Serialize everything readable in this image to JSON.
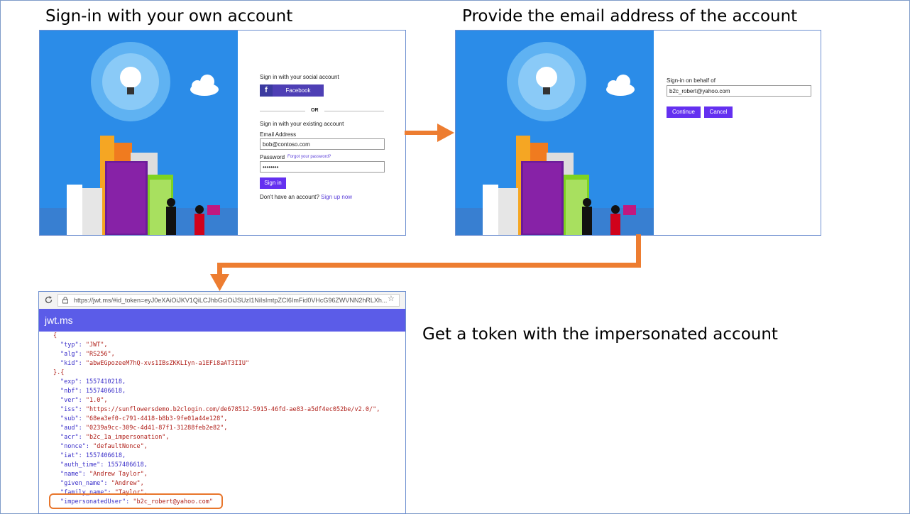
{
  "captions": {
    "step1": "Sign-in with your own account",
    "step2": "Provide the email address of the account",
    "step3": "Get a token with the impersonated account"
  },
  "signin": {
    "social_title": "Sign in with your social account",
    "facebook_label": "Facebook",
    "or_label": "OR",
    "existing_title": "Sign in with your existing account",
    "email_label": "Email Address",
    "email_value": "bob@contoso.com",
    "password_label": "Password",
    "forgot_link": "Forgot your password?",
    "password_value": "••••••••",
    "signin_button": "Sign in",
    "no_account": "Don't have an account?",
    "signup_link": "Sign up now"
  },
  "behalf": {
    "label": "Sign-in on behalf of",
    "value": "b2c_robert@yahoo.com",
    "continue_button": "Continue",
    "cancel_button": "Cancel"
  },
  "browser": {
    "url": "https://jwt.ms/#id_token=eyJ0eXAiOiJKV1QiLCJhbGciOiJSUzI1NiIsImtpZCI6ImFid0VHcG96ZWVNN2hRLXh...",
    "site_title": "jwt.ms",
    "refresh_icon": "refresh-icon",
    "lock_icon": "lock-icon",
    "star_icon": "star-icon"
  },
  "token": {
    "header": [
      {
        "key": "\"typ\"",
        "val": "\"JWT\","
      },
      {
        "key": "\"alg\"",
        "val": "\"RS256\","
      },
      {
        "key": "\"kid\"",
        "val": "\"abwEGpozeeM7hQ-xvs1IBsZKKLIyn-a1EFi8aAT3IIU\""
      }
    ],
    "claims": [
      {
        "key": "\"exp\"",
        "val": "1557410218,",
        "num": true
      },
      {
        "key": "\"nbf\"",
        "val": "1557406618,",
        "num": true
      },
      {
        "key": "\"ver\"",
        "val": "\"1.0\","
      },
      {
        "key": "\"iss\"",
        "val": "\"https://sunflowersdemo.b2clogin.com/de678512-5915-46fd-ae83-a5df4ec052be/v2.0/\","
      },
      {
        "key": "\"sub\"",
        "val": "\"68ea3ef0-c791-4418-b8b3-9fe01a44e128\","
      },
      {
        "key": "\"aud\"",
        "val": "\"0239a9cc-309c-4d41-87f1-31288feb2e82\","
      },
      {
        "key": "\"acr\"",
        "val": "\"b2c_1a_impersonation\","
      },
      {
        "key": "\"nonce\"",
        "val": "\"defaultNonce\","
      },
      {
        "key": "\"iat\"",
        "val": "1557406618,",
        "num": true
      },
      {
        "key": "\"auth_time\"",
        "val": "1557406618,",
        "num": true
      },
      {
        "key": "\"name\"",
        "val": "\"Andrew Taylor\","
      },
      {
        "key": "\"given_name\"",
        "val": "\"Andrew\","
      },
      {
        "key": "\"family_name\"",
        "val": "\"Taylor\","
      },
      {
        "key": "\"impersonatedUser\"",
        "val": "\"b2c_robert@yahoo.com\""
      }
    ],
    "open_brace": "{",
    "sep": "}.{"
  },
  "colors": {
    "accent_purple": "#6430f0",
    "arrow_orange": "#ed7d31",
    "jwt_bar": "#5b5ce8",
    "art_blue": "#1e88e5"
  }
}
